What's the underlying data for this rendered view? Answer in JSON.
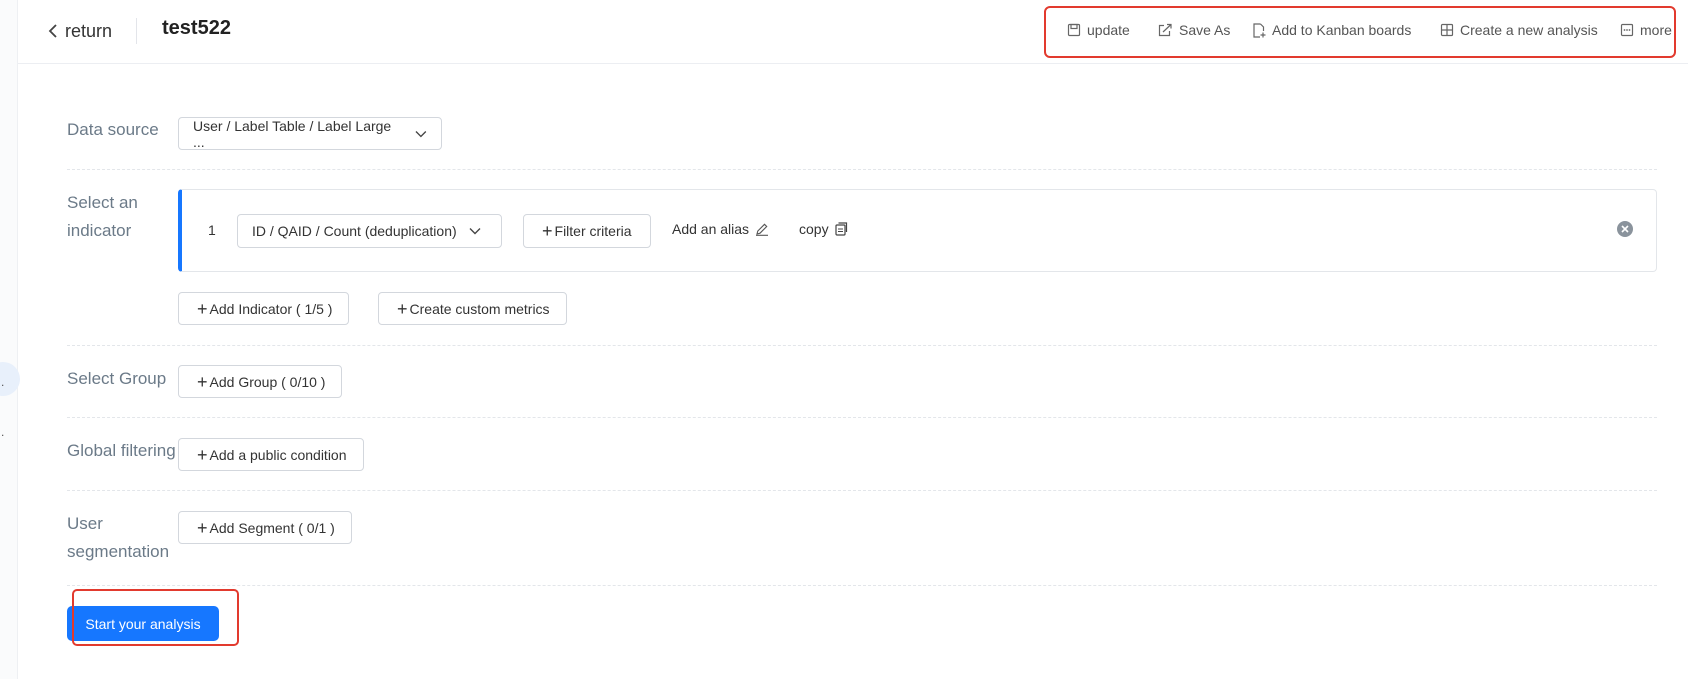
{
  "header": {
    "return_label": "return",
    "title": "test522"
  },
  "toolbar": {
    "update_label": "update",
    "save_as_label": "Save As",
    "kanban_label": "Add to Kanban boards",
    "create_analysis_label": "Create a new analysis",
    "more_label": "more"
  },
  "form": {
    "data_source": {
      "label": "Data source",
      "value": "User / Label Table / Label Large ..."
    },
    "indicator": {
      "label_line1": "Select an",
      "label_line2": "indicator",
      "items": [
        {
          "index": "1",
          "metric": "ID / QAID / Count (deduplication)",
          "filter_label": "Filter criteria",
          "alias_label": "Add an alias",
          "copy_label": "copy"
        }
      ],
      "add_indicator_label": "Add Indicator ( 1/5 )",
      "custom_metrics_label": "Create custom metrics"
    },
    "group": {
      "label": "Select Group",
      "add_label": "Add Group ( 0/10 )"
    },
    "global_filter": {
      "label": "Global filtering",
      "add_label": "Add a public condition"
    },
    "segmentation": {
      "label_line1": "User",
      "label_line2": "segmentation",
      "add_label": "Add Segment ( 0/1 )"
    },
    "start_label": "Start your analysis"
  },
  "sidebar": {
    "truncated_a": ".",
    "truncated_b": "."
  },
  "colors": {
    "primary": "#1677ff",
    "highlight": "#e23a2e",
    "label": "#6b7a88"
  }
}
